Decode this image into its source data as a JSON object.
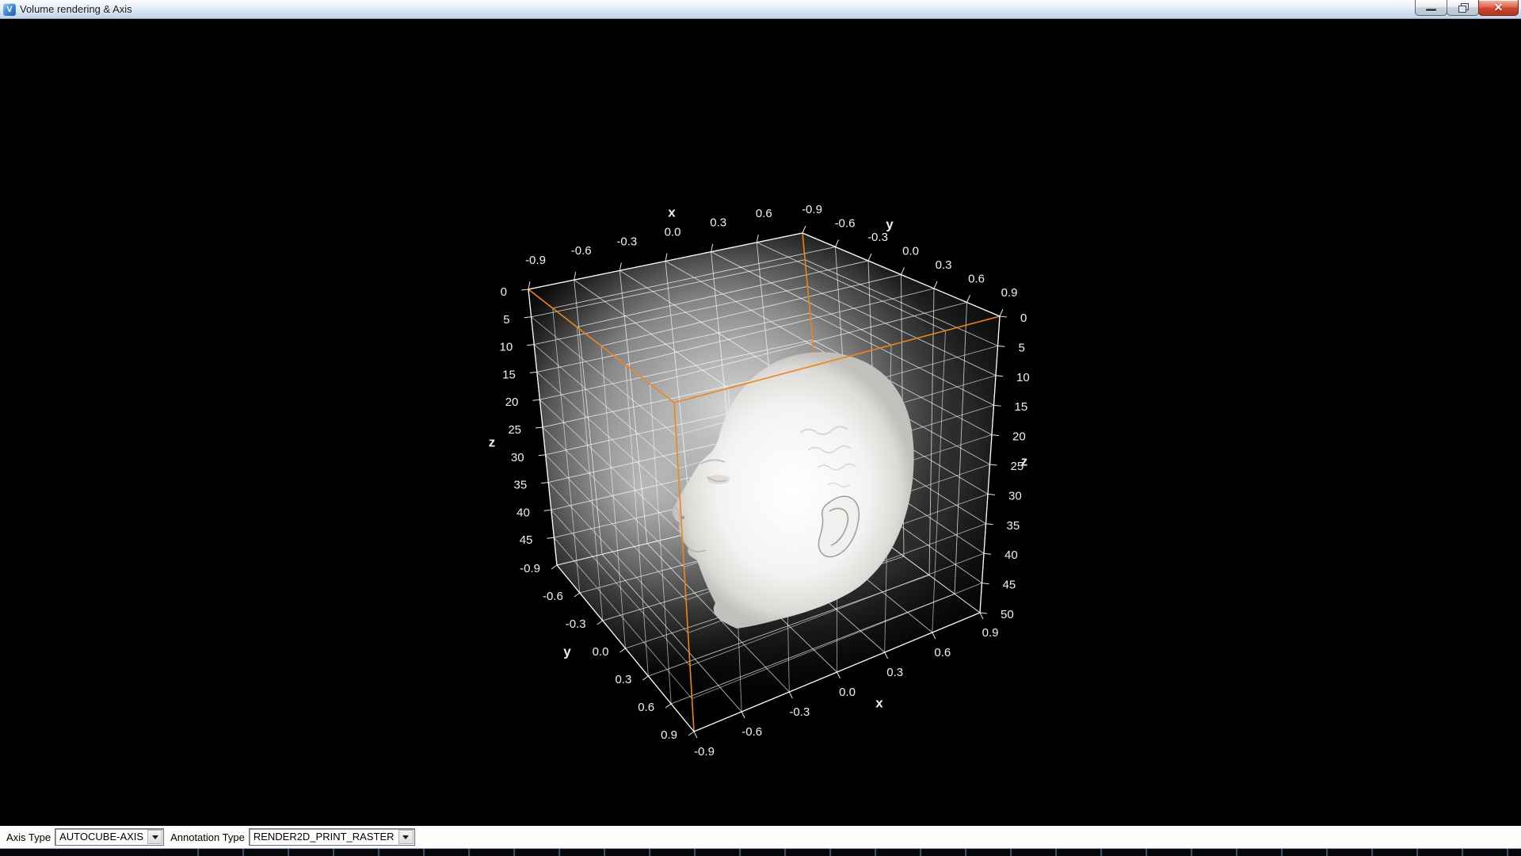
{
  "window": {
    "title": "Volume rendering & Axis",
    "icon_letter": "V",
    "controls": {
      "close_glyph": "✕"
    }
  },
  "toolbar": {
    "axis_type_label": "Axis Type",
    "axis_type_value": "AUTOCUBE-AXIS",
    "annotation_type_label": "Annotation Type",
    "annotation_type_value": "RENDER2D_PRINT_RASTER"
  },
  "scene": {
    "object": "volume-rendered human head inside auto-cube axes",
    "colors": {
      "background": "#000000",
      "grid": "#ffffff",
      "highlight_edge": "#f08418",
      "label": "#f0f0f0"
    },
    "axes": {
      "x_top": {
        "title": "x",
        "ticks": [
          "-0.9",
          "-0.6",
          "-0.3",
          "0.0",
          "0.3",
          "0.6"
        ]
      },
      "y_top": {
        "title": "y",
        "ticks": [
          "-0.9",
          "-0.6",
          "-0.3",
          "0.0",
          "0.3",
          "0.6",
          "0.9"
        ]
      },
      "z_left": {
        "title": "z",
        "ticks": [
          "0",
          "5",
          "10",
          "15",
          "20",
          "25",
          "30",
          "35",
          "40",
          "45"
        ]
      },
      "z_right": {
        "title": "z",
        "ticks": [
          "0",
          "5",
          "10",
          "15",
          "20",
          "25",
          "30",
          "35",
          "40",
          "45",
          "50"
        ]
      },
      "y_bottom": {
        "title": "y",
        "ticks": [
          "-0.9",
          "-0.6",
          "-0.3",
          "0.0",
          "0.3",
          "0.6",
          "0.9"
        ]
      },
      "x_bottom": {
        "title": "x",
        "ticks": [
          "-0.9",
          "-0.6",
          "-0.3",
          "0.0",
          "0.3",
          "0.6",
          "0.9"
        ]
      }
    },
    "ranges": {
      "x": [
        -0.9,
        0.9
      ],
      "y": [
        -0.9,
        0.9
      ],
      "z": [
        0,
        50
      ]
    }
  }
}
